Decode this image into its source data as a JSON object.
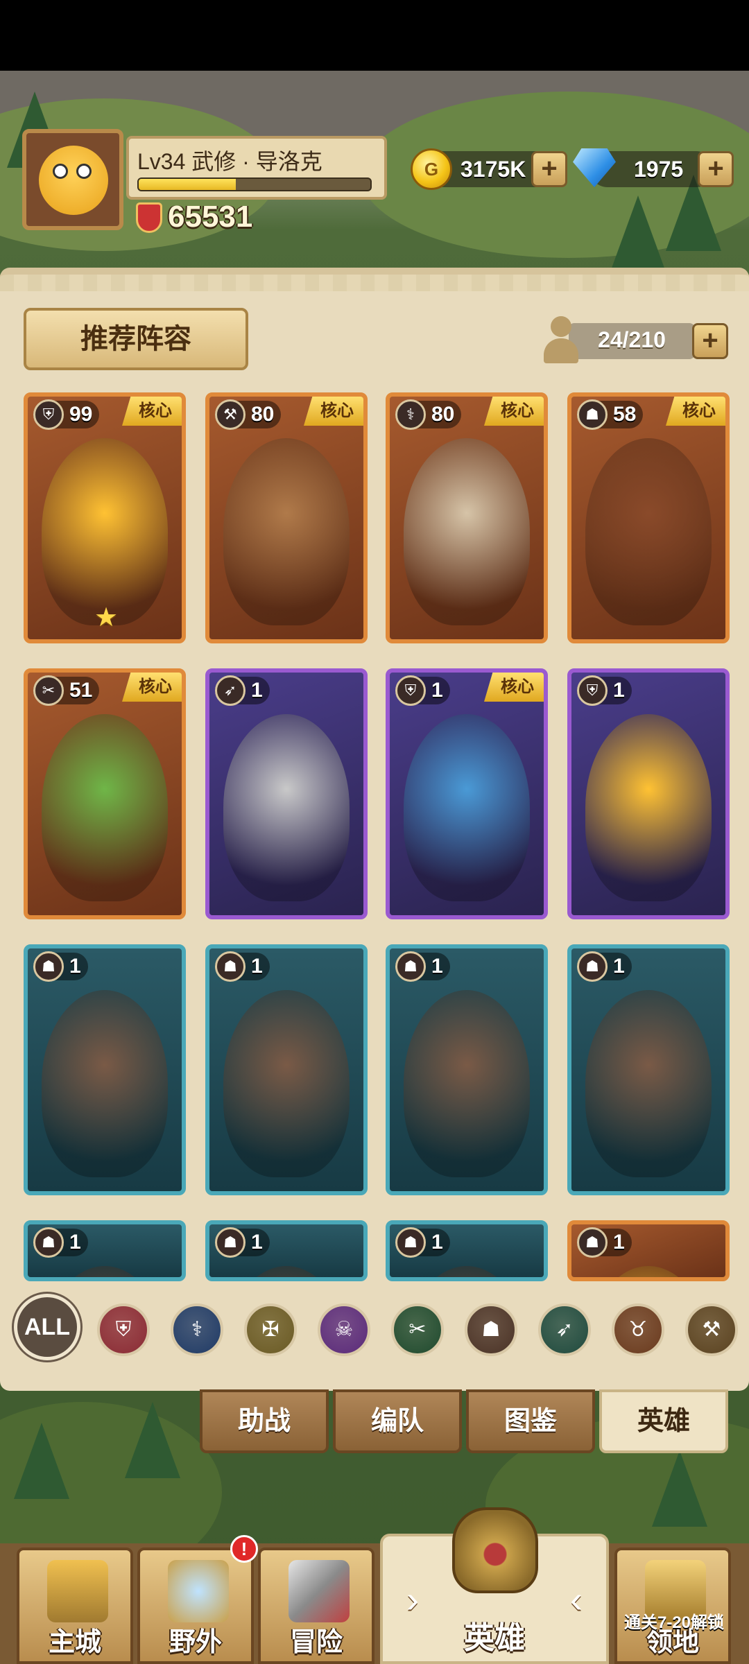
{
  "player": {
    "level_name": "Lv34  武修 · 导洛克",
    "xp_fraction": 0.42,
    "power": "65531"
  },
  "currency": {
    "gold": "3175K",
    "gems": "1975",
    "gold_icon": "coin-icon",
    "gem_icon": "diamond-icon",
    "plus_symbol": "+"
  },
  "roster": {
    "recommend_label": "推荐阵容",
    "slots": "24/210",
    "plus_symbol": "+"
  },
  "heroes": [
    {
      "level": "99",
      "core": "核心",
      "role": "guardian",
      "role_glyph": "⛨",
      "rarity": "orange",
      "star": "★"
    },
    {
      "level": "80",
      "core": "核心",
      "role": "warrior",
      "role_glyph": "⚒",
      "rarity": "orange"
    },
    {
      "level": "80",
      "core": "核心",
      "role": "mage",
      "role_glyph": "⚕",
      "rarity": "orange"
    },
    {
      "level": "58",
      "core": "核心",
      "role": "beast",
      "role_glyph": "☗",
      "rarity": "orange"
    },
    {
      "level": "51",
      "core": "核心",
      "role": "assassin",
      "role_glyph": "✂",
      "rarity": "orange"
    },
    {
      "level": "1",
      "core": "",
      "role": "ranger",
      "role_glyph": "➶",
      "rarity": "purple"
    },
    {
      "level": "1",
      "core": "核心",
      "role": "guardian",
      "role_glyph": "⛨",
      "rarity": "purple"
    },
    {
      "level": "1",
      "core": "",
      "role": "guardian",
      "role_glyph": "⛨",
      "rarity": "purple"
    },
    {
      "level": "1",
      "core": "",
      "role": "beast",
      "role_glyph": "☗",
      "rarity": "teal"
    },
    {
      "level": "1",
      "core": "",
      "role": "beast",
      "role_glyph": "☗",
      "rarity": "teal"
    },
    {
      "level": "1",
      "core": "",
      "role": "beast",
      "role_glyph": "☗",
      "rarity": "teal"
    },
    {
      "level": "1",
      "core": "",
      "role": "beast",
      "role_glyph": "☗",
      "rarity": "teal"
    },
    {
      "level": "1",
      "core": "",
      "role": "beast",
      "role_glyph": "☗",
      "rarity": "teal"
    },
    {
      "level": "1",
      "core": "",
      "role": "beast",
      "role_glyph": "☗",
      "rarity": "teal"
    },
    {
      "level": "1",
      "core": "",
      "role": "beast",
      "role_glyph": "☗",
      "rarity": "teal"
    },
    {
      "level": "1",
      "core": "",
      "role": "beast",
      "role_glyph": "☗",
      "rarity": "orange"
    }
  ],
  "filters": {
    "all_label": "ALL",
    "icons": [
      {
        "name": "shield-filter-icon",
        "glyph": "⛨",
        "color": "#8a2a34"
      },
      {
        "name": "staff-filter-icon",
        "glyph": "⚕",
        "color": "#1f3a66"
      },
      {
        "name": "emblem-filter-icon",
        "glyph": "✠",
        "color": "#6a5a24"
      },
      {
        "name": "skull-filter-icon",
        "glyph": "☠",
        "color": "#5a2a7a"
      },
      {
        "name": "crossed-daggers-filter-icon",
        "glyph": "✂",
        "color": "#1f4a2e"
      },
      {
        "name": "paw-filter-icon",
        "glyph": "☗",
        "color": "#4a3226"
      },
      {
        "name": "bow-filter-icon",
        "glyph": "➶",
        "color": "#1f4a3e"
      },
      {
        "name": "bull-filter-icon",
        "glyph": "♉",
        "color": "#6a3a1e"
      },
      {
        "name": "hammer-filter-icon",
        "glyph": "⚒",
        "color": "#5a4220"
      }
    ]
  },
  "subtabs": [
    "助战",
    "编队",
    "图鉴",
    "英雄"
  ],
  "nav": {
    "city": "主城",
    "wild": "野外",
    "wild_badge": "!",
    "adventure": "冒险",
    "hero": "英雄",
    "territory": "领地",
    "territory_lock": "通关7-20解锁",
    "left_arrow": "›",
    "right_arrow": "‹"
  }
}
